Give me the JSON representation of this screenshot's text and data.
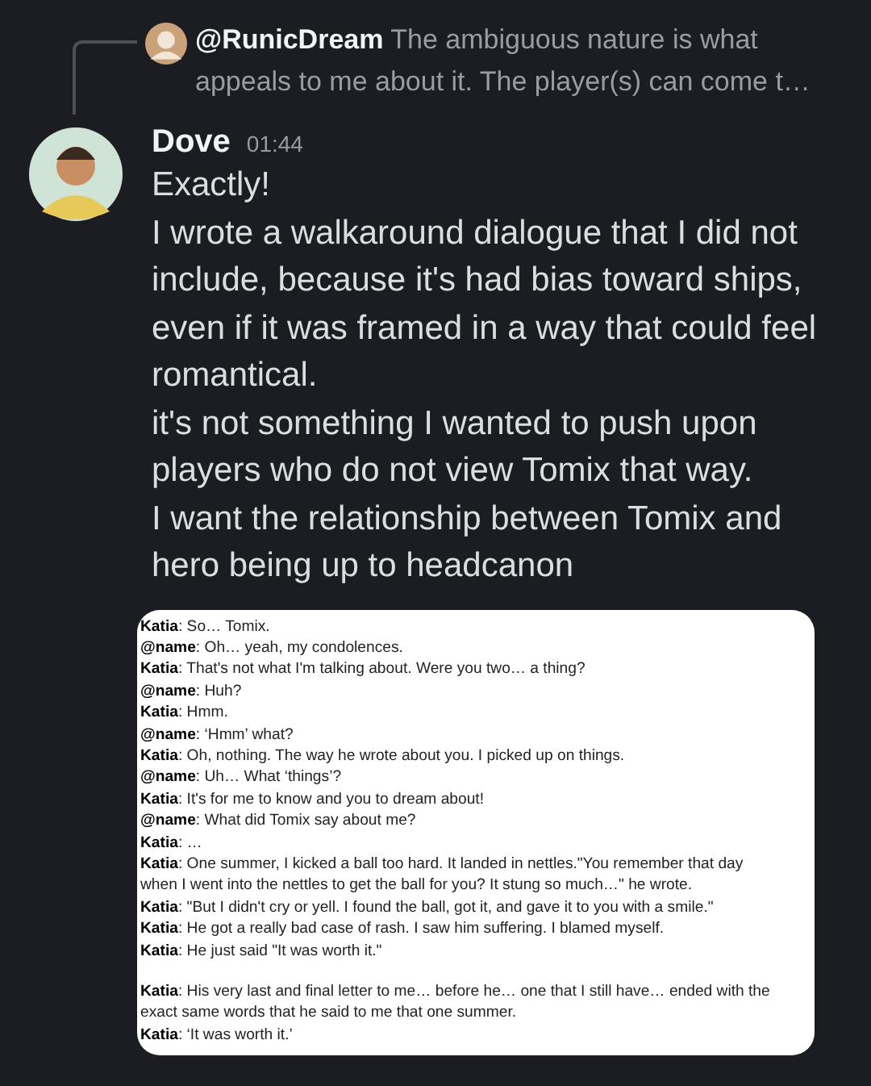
{
  "reply": {
    "author": "@RunicDream",
    "text": "The ambiguous nature is what appeals to me about it. The player(s) can come t…"
  },
  "message": {
    "author": "Dove",
    "time": "01:44",
    "paragraphs": [
      "Exactly!",
      "I wrote a walkaround dialogue that I did not include, because it's had bias toward ships, even if it was framed in a way that could feel romantical.",
      "it's not something I wanted to push upon players who do not view Tomix that way.",
      "I want the relationship between Tomix and hero being up to headcanon"
    ]
  },
  "attachment": {
    "blocks": [
      {
        "lines": [
          "**Katia**: So… Tomix.",
          "**@name**: Oh… yeah, my condolences.",
          "**Katia**: That's not what I'm talking about. Were you two… a thing?",
          "**@name**: Huh?",
          "**Katia**: Hmm.",
          "**@name**: ‘Hmm’ what?",
          "**Katia**: Oh, nothing. The way he wrote about you. I picked up on things.",
          "**@name**: Uh… What ‘things’?",
          "**Katia**: It's for me to know and you to dream about!",
          "**@name**: What did Tomix say about me?",
          "**Katia**: …",
          "**Katia**: One summer, I kicked a ball too hard. It landed in nettles.\"You remember that day",
          "when I went into the nettles to get the ball for you? It stung so much…\" he wrote.",
          "**Katia**: \"But I didn't cry or yell. I found the ball, got it, and gave it to you with a smile.\"",
          "**Katia**: He got a really bad case of rash. I saw him suffering. I blamed myself.",
          "**Katia**: He just said \"It was worth it.\""
        ]
      },
      {
        "lines": [
          "**Katia**: His very last and final letter to me… before he… one that I still have… ended with the",
          "exact same words that he said to me that one summer.",
          "**Katia**: ‘It was worth it.’"
        ]
      }
    ]
  }
}
